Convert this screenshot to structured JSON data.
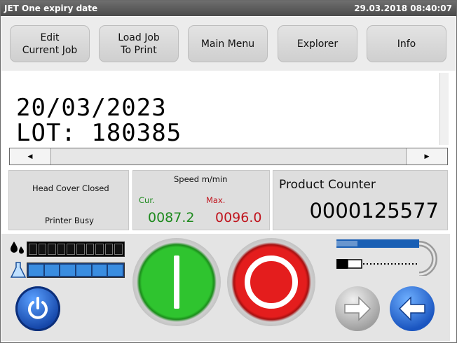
{
  "titlebar": {
    "title": "JET One expiry date",
    "datetime": "29.03.2018 08:40:07"
  },
  "nav": [
    {
      "label": "Edit\nCurrent Job"
    },
    {
      "label": "Load Job\nTo Print"
    },
    {
      "label": "Main Menu"
    },
    {
      "label": "Explorer"
    },
    {
      "label": "Info"
    }
  ],
  "preview": {
    "line1": "20/03/2023",
    "line2": "LOT: 180385"
  },
  "status": {
    "head_cover": "Head Cover Closed",
    "printer_state": "Printer Busy",
    "speed_label": "Speed   m/min",
    "cur_label": "Cur.",
    "max_label": "Max.",
    "cur_value": "0087.2",
    "max_value": "0096.0",
    "counter_label": "Product Counter",
    "counter_value": "0000125577"
  },
  "levels": {
    "ink": {
      "segments": 10,
      "filled": 0
    },
    "solvent": {
      "segments": 6,
      "filled": 6
    }
  },
  "colors": {
    "start": "#22a822",
    "stop": "#e01818",
    "speed_cur": "#1e8a1e",
    "speed_max": "#c0151e",
    "solvent": "#3a8de0"
  },
  "icons": [
    "scroll-left-icon",
    "scroll-right-icon",
    "ink-drop-icon",
    "solvent-flask-icon",
    "power-icon",
    "start-icon",
    "stop-icon",
    "printhead-icon",
    "forward-arrow-icon",
    "back-arrow-icon"
  ]
}
